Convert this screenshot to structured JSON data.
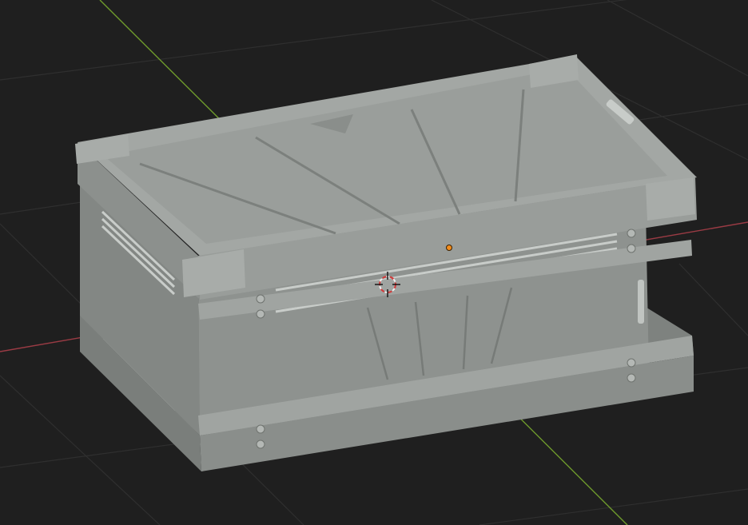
{
  "viewport": {
    "background": "#1f1f1f",
    "grid_color": "#2e2e2e",
    "x_axis_color": "#9a3b44",
    "y_axis_color": "#6e9a2c",
    "model_base_color": "#8e928f",
    "model_top_color": "#a3a7a4",
    "model_dark_color": "#6e726f",
    "origin_color": "#f28c1c",
    "cursor_color": "#d23a3a"
  },
  "scene": {
    "object": "crate-model",
    "icons": [
      "3d-cursor-icon",
      "object-origin-icon"
    ]
  }
}
